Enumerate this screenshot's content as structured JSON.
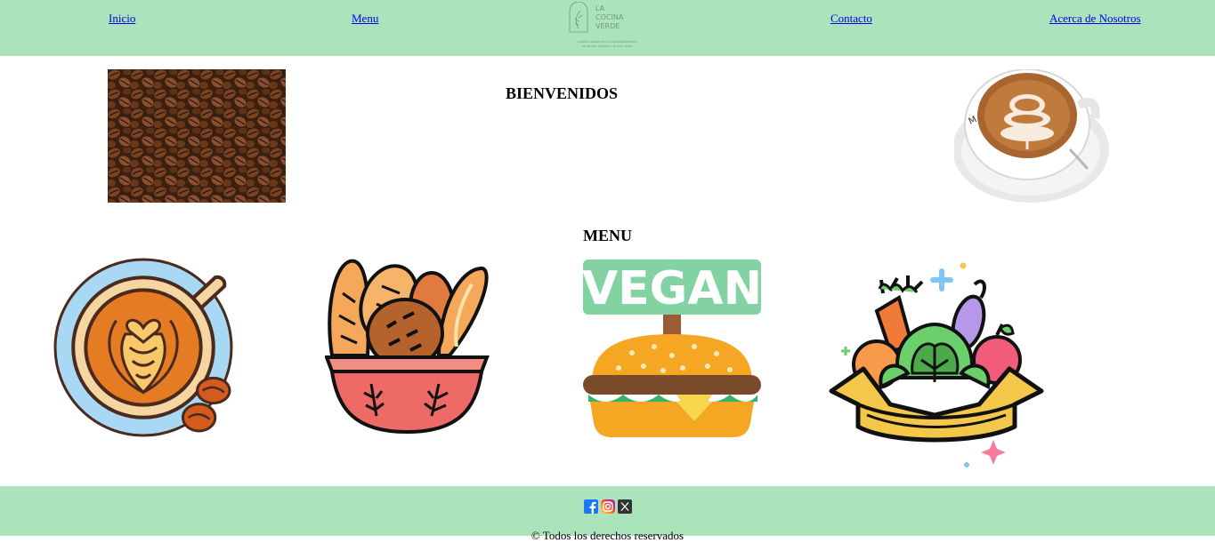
{
  "nav": {
    "links": [
      "Inicio",
      "Menu",
      "Contacto",
      "Acerca de Nosotros"
    ],
    "logo": {
      "line1": "LA",
      "line2": "COCINA",
      "line3": "VERDE",
      "tagline1": "COMIDA CASERA HECHA CON INGREDIENTES",
      "tagline2": "DE ORIGEN VEGETAL Y MUCHO AMOR"
    }
  },
  "welcome": {
    "title": "BIENVENIDOS"
  },
  "menu": {
    "title": "MENU",
    "vegan_label": "VEGAN"
  },
  "footer": {
    "copyright": "© Todos los derechos reservados"
  },
  "colors": {
    "header_bg": "#abe3bd",
    "link": "#0000ee",
    "facebook": "#1877f2",
    "vegan_sign": "#82d3a1"
  },
  "icons": [
    "facebook-icon",
    "instagram-icon",
    "x-twitter-icon"
  ]
}
